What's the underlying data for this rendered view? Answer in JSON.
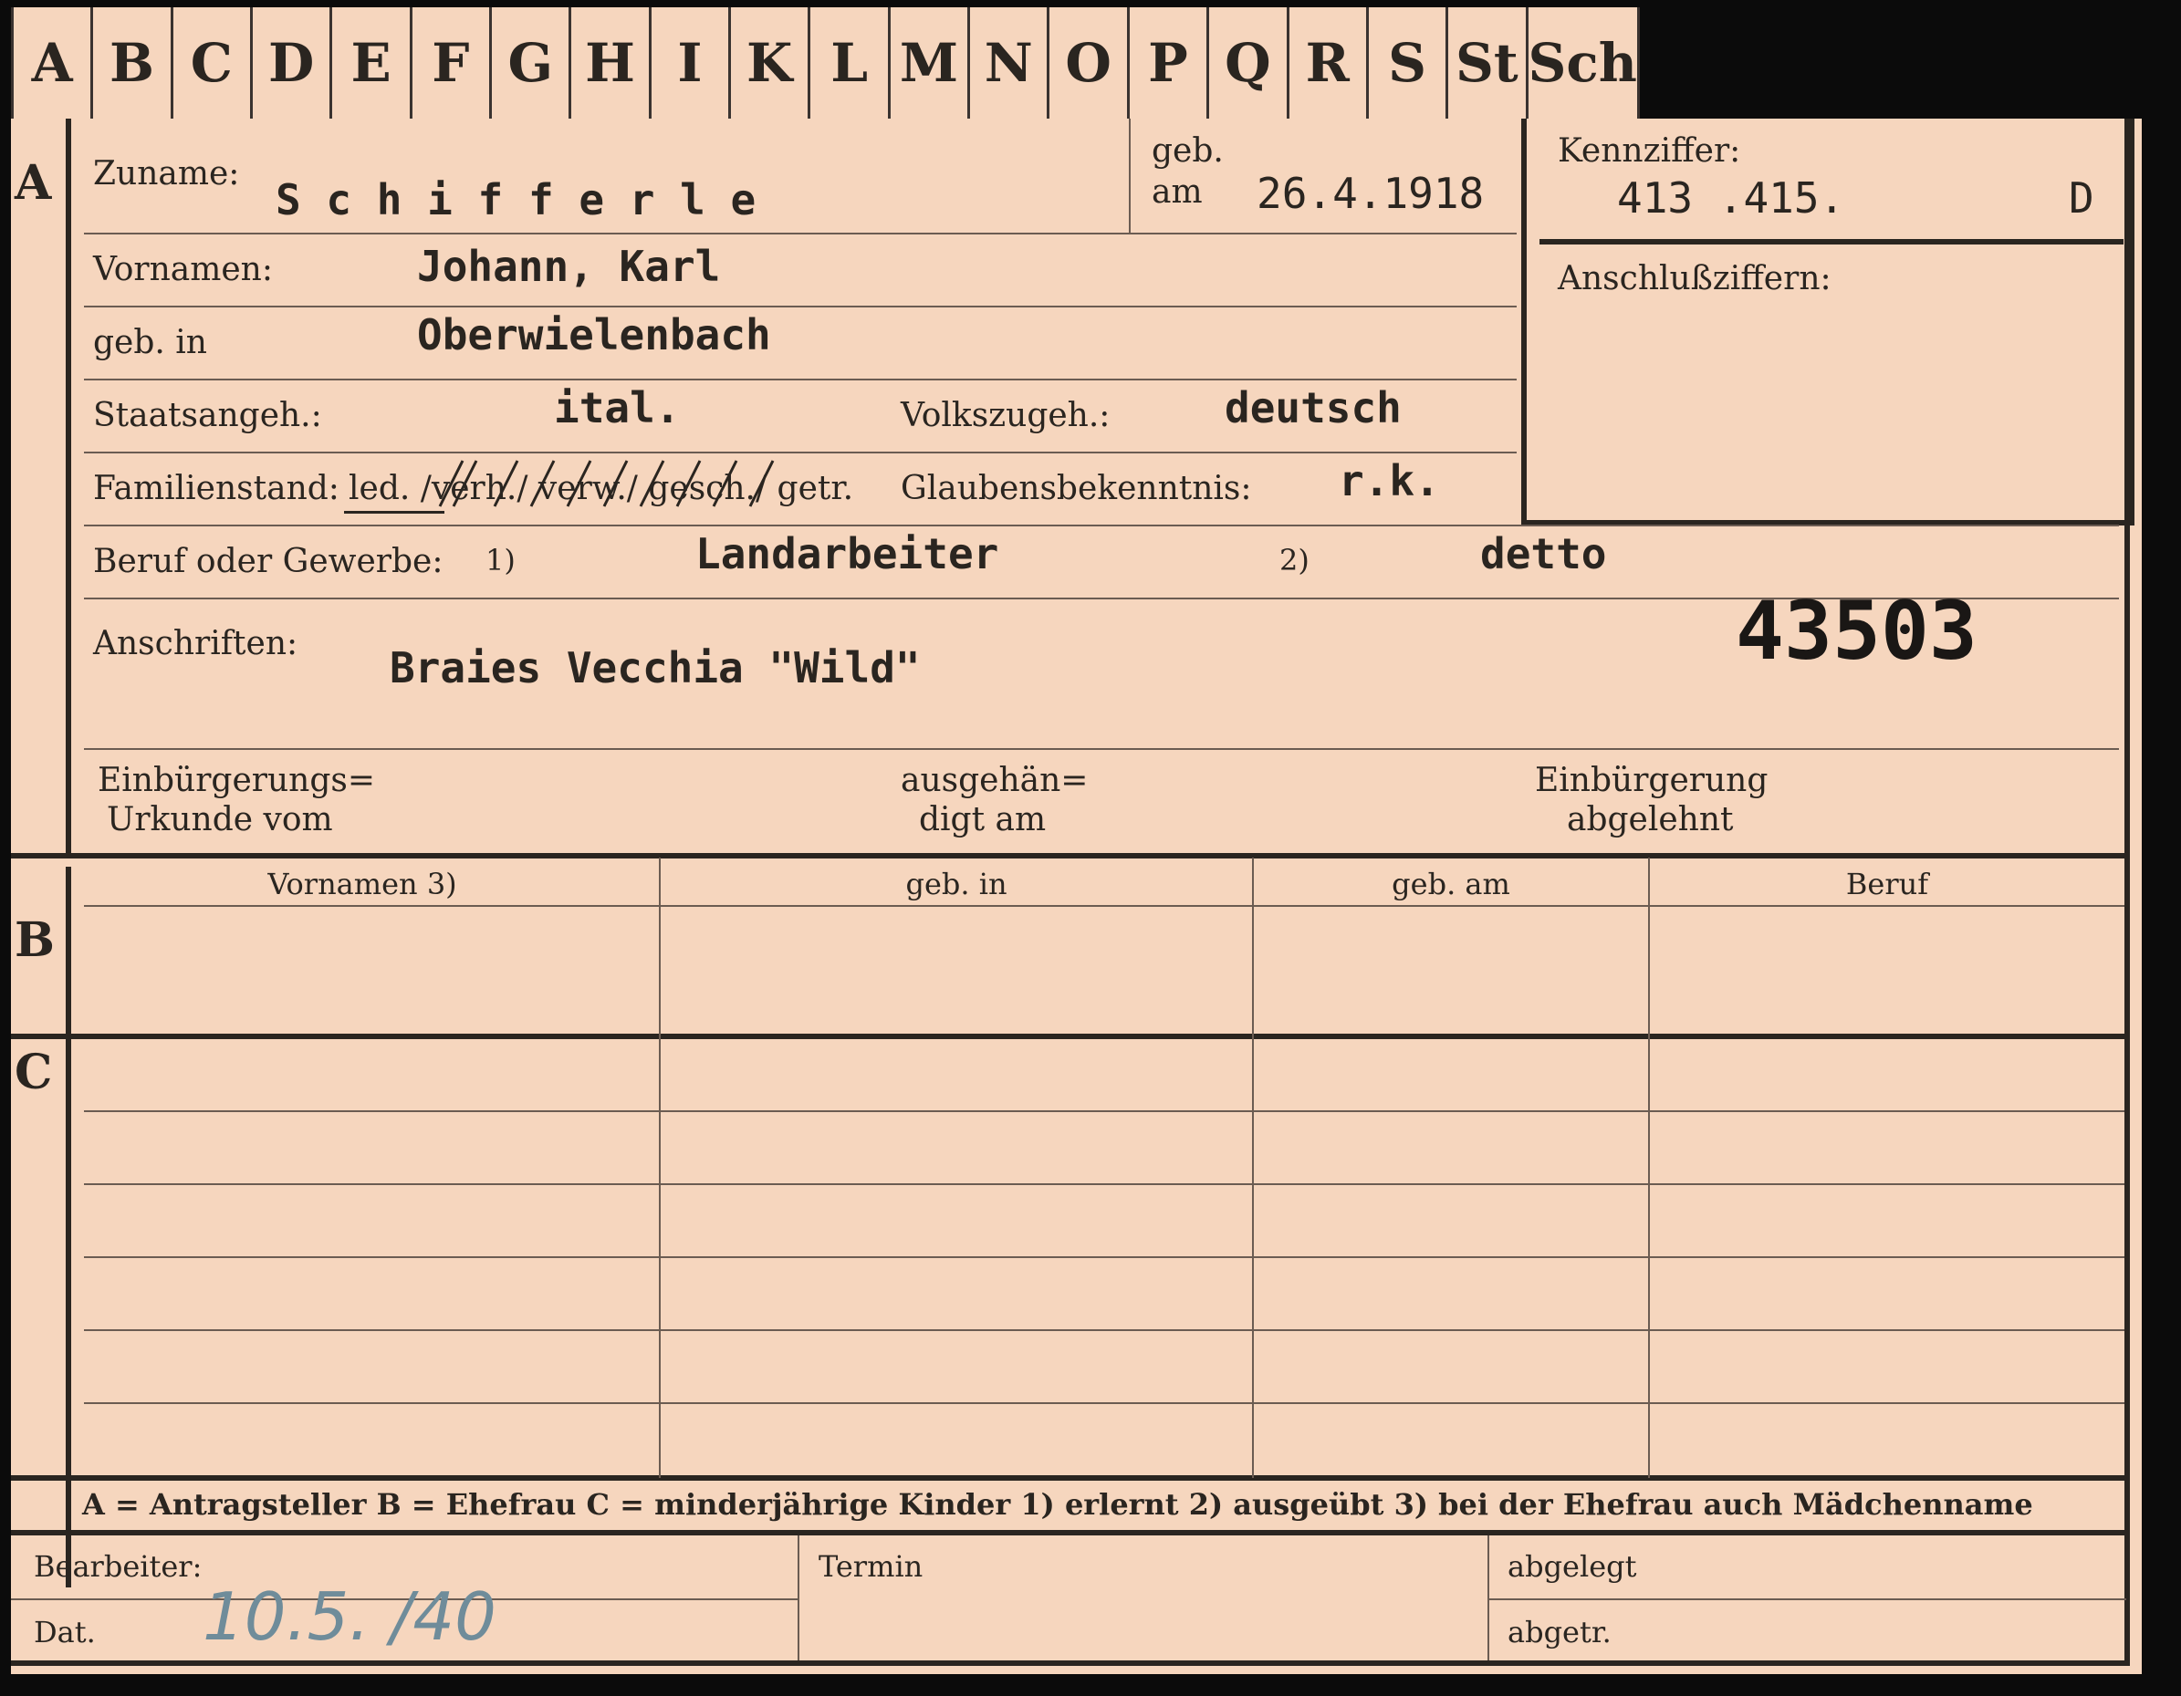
{
  "index_tabs": [
    "A",
    "B",
    "C",
    "D",
    "E",
    "F",
    "G",
    "H",
    "I",
    "K",
    "L",
    "M",
    "N",
    "O",
    "P",
    "Q",
    "R",
    "S",
    "St",
    "Sch"
  ],
  "section_a": {
    "marker": "A",
    "surname_label": "Zuname:",
    "surname": "S c h i f f e r l e",
    "born_on_label_1": "geb.",
    "born_on_label_2": "am",
    "born_on": "26.4.1918",
    "given_names_label": "Vornamen:",
    "given_names": "Johann, Karl",
    "born_in_label": "geb. in",
    "born_in": "Oberwielenbach",
    "citizenship_label": "Staatsangeh.:",
    "citizenship": "ital.",
    "ethnicity_label": "Volkszugeh.:",
    "ethnicity": "deutsch",
    "marital_label": "Familienstand:",
    "marital_options": "led. /verh./ verw./ gesch./ getr.",
    "religion_label": "Glaubensbekenntnis:",
    "religion": "r.k.",
    "occupation_label": "Beruf oder Gewerbe:",
    "occupation_fn1": "1)",
    "occupation_learned": "Landarbeiter",
    "occupation_fn2": "2)",
    "occupation_practiced": "detto",
    "address_label": "Anschriften:",
    "address": "Braies Vecchia  \"Wild\"",
    "stamp_number": "43503",
    "naturalization_doc_label_1": "Einbürgerungs=",
    "naturalization_doc_label_2": "Urkunde vom",
    "handed_out_label_1": "ausgehän=",
    "handed_out_label_2": "digt am",
    "naturalization_refused_label_1": "Einbürgerung",
    "naturalization_refused_label_2": "abgelehnt"
  },
  "ref_box": {
    "code_label": "Kennziffer:",
    "code": "413 .415.",
    "code_suffix": "D",
    "sub_codes_label": "Anschlußziffern:"
  },
  "section_b": {
    "marker": "B",
    "columns": [
      "Vornamen 3)",
      "geb. in",
      "geb. am",
      "Beruf"
    ]
  },
  "section_c": {
    "marker": "C"
  },
  "legend": {
    "text": "A = Antragsteller   B = Ehefrau   C = minderjährige Kinder   1) erlernt   2) ausgeübt   3) bei der Ehefrau auch Mädchenname"
  },
  "footer": {
    "clerk_label": "Bearbeiter:",
    "date_label": "Dat.",
    "date_value": "10.5.  /40",
    "deadline_label": "Termin",
    "filed_label": "abgelegt",
    "abgetr_label": "abgetr."
  },
  "colors": {
    "card": "#f6d6be",
    "ink": "#2a2520",
    "pencil": "#6f8c9a"
  }
}
